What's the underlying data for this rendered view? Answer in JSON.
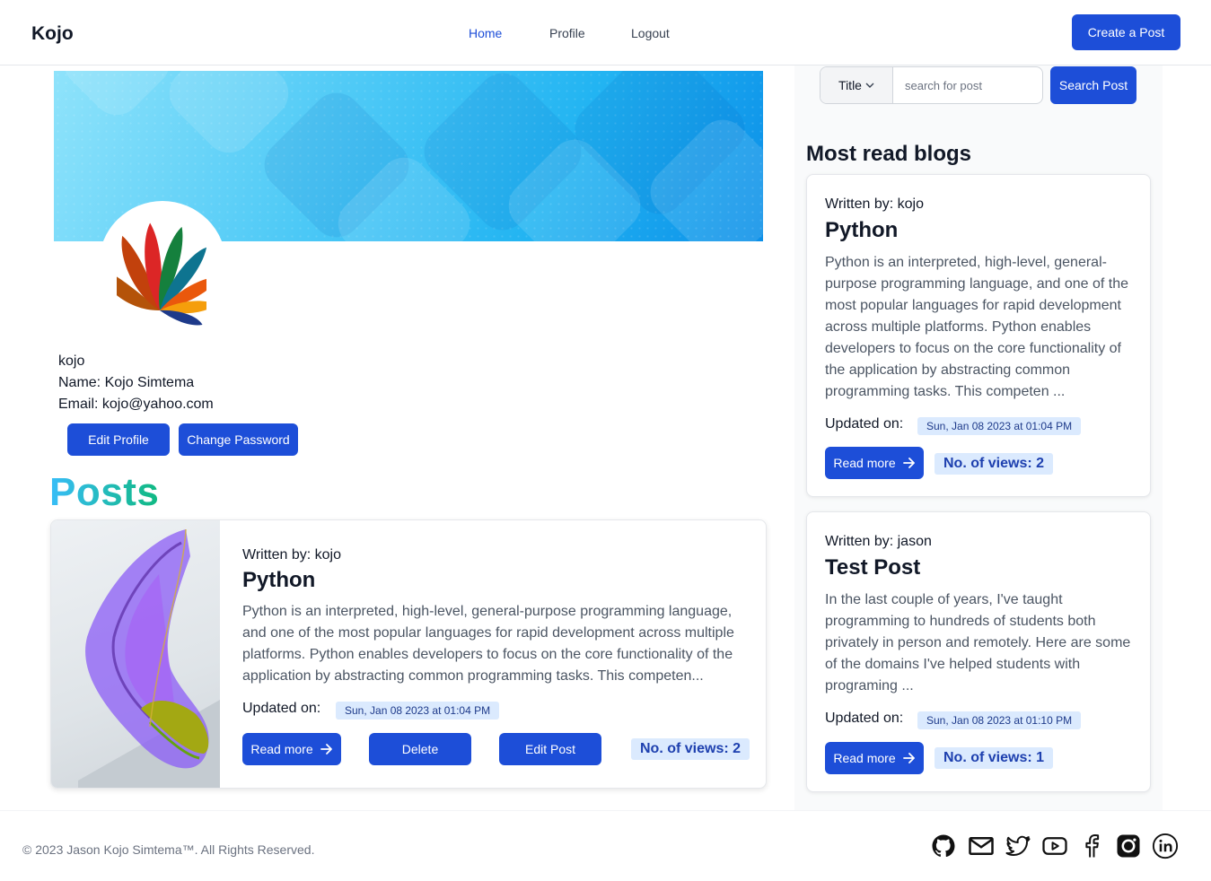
{
  "nav": {
    "brand": "Kojo",
    "links": [
      "Home",
      "Profile",
      "Logout"
    ],
    "active": "Home",
    "create_label": "Create a Post"
  },
  "profile": {
    "username": "kojo",
    "name_line": "Name: Kojo Simtema",
    "email_line": "Email: kojo@yahoo.com",
    "edit_label": "Edit Profile",
    "change_password_label": "Change Password"
  },
  "posts": {
    "heading": "Posts",
    "items": [
      {
        "written_by": "Written by: kojo",
        "title": "Python",
        "excerpt": "Python is an interpreted, high-level, general-purpose programming language, and one of the most popular languages for rapid development across multiple platforms. Python enables developers to focus on the core functionality of the application by abstracting common programming tasks. This competen...",
        "updated_label": "Updated on:",
        "updated": "Sun, Jan 08 2023 at 01:04 PM",
        "read_more": "Read more",
        "delete_label": "Delete",
        "edit_label": "Edit Post",
        "views": "No. of views: 2"
      }
    ]
  },
  "search": {
    "filter": "Title",
    "placeholder": "search for post",
    "button": "Search Post"
  },
  "sidebar": {
    "heading": "Most read blogs",
    "cards": [
      {
        "written_by": "Written by: kojo",
        "title": "Python",
        "excerpt": "Python is an interpreted, high-level, general-purpose programming language, and one of the most popular languages for rapid development across multiple platforms. Python enables developers to focus on the core functionality of the application by abstracting common programming tasks. This competen ...",
        "updated_label": "Updated on:",
        "updated": "Sun, Jan 08 2023 at 01:04 PM",
        "read_more": "Read more",
        "views": "No. of views: 2"
      },
      {
        "written_by": "Written by: jason",
        "title": "Test Post",
        "excerpt": "In the last couple of years, I've taught programming to hundreds of students both privately in person and remotely. Here are some of the domains I've helped students with programing ...",
        "updated_label": "Updated on:",
        "updated": "Sun, Jan 08 2023 at 01:10 PM",
        "read_more": "Read more",
        "views": "No. of views: 1"
      }
    ]
  },
  "footer": {
    "copyright": "© 2023 Jason Kojo Simtema™. All Rights Reserved.",
    "social": [
      "github-icon",
      "mail-icon",
      "twitter-icon",
      "youtube-icon",
      "facebook-icon",
      "instagram-icon",
      "linkedin-icon"
    ]
  },
  "colors": {
    "accent": "#1d4ed8",
    "badge_bg": "#dbeafe",
    "posts_gradient_start": "#38bdf8",
    "posts_gradient_end": "#10b981"
  }
}
